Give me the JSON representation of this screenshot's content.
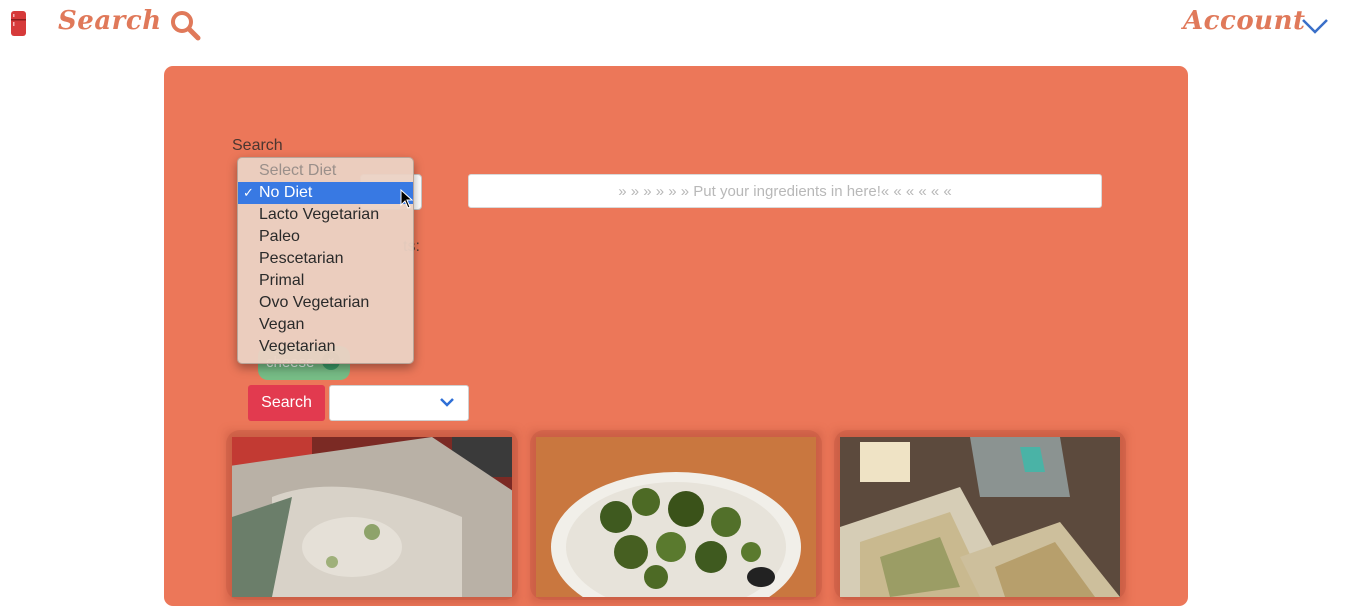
{
  "nav": {
    "logo_icon": "fridge-icon",
    "search_label": "Search",
    "search_icon": "search-icon",
    "account_label": "Account",
    "account_chevron": "chevron-down-icon"
  },
  "colors": {
    "brand": "#e0795a",
    "panel": "#ec7759",
    "primary_button": "#e23a4f",
    "tag": "#63c98e",
    "selection": "#3879e3"
  },
  "search_form": {
    "section_label": "Search",
    "ingredients_label_partial": "ts:",
    "diet_select": {
      "selected": "No Diet",
      "options": [
        {
          "label": "Select Diet",
          "disabled": true
        },
        {
          "label": "No Diet",
          "selected": true
        },
        {
          "label": "Lacto Vegetarian"
        },
        {
          "label": "Paleo"
        },
        {
          "label": "Pescetarian"
        },
        {
          "label": "Primal"
        },
        {
          "label": "Ovo Vegetarian"
        },
        {
          "label": "Vegan"
        },
        {
          "label": "Vegetarian"
        }
      ]
    },
    "ingredients_placeholder": "» » » » » » Put your ingredients in here!« « « « « «",
    "tags": [
      {
        "label": "cheese",
        "remove_icon": "close-icon"
      }
    ],
    "search_button": "Search",
    "sort_select": {
      "selected": ""
    }
  },
  "recipes": [
    {
      "image": "wrap-photo"
    },
    {
      "image": "roasted-broccoli-photo"
    },
    {
      "image": "quesadilla-photo"
    }
  ]
}
